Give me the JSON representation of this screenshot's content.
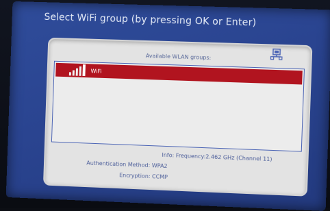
{
  "screen": {
    "title": "Select WiFi group (by pressing OK or Enter)"
  },
  "panel": {
    "header": "Available WLAN groups:",
    "icons": {
      "network": "network-icon"
    },
    "items": [
      {
        "label": "WiFi",
        "signal_icon": "signal-strength-icon",
        "selected": true
      }
    ],
    "info": {
      "frequency": "Info: Frequency:2.462 GHz (Channel 11)",
      "auth": "Authentication Method: WPA2",
      "encryption": "Encryption: CCMP"
    }
  },
  "colors": {
    "screen_bg": "#2a4490",
    "panel_bg": "#e3e3e3",
    "selection": "#b1141f",
    "border": "#4b64b5",
    "text_blue": "#4c5e9a"
  }
}
